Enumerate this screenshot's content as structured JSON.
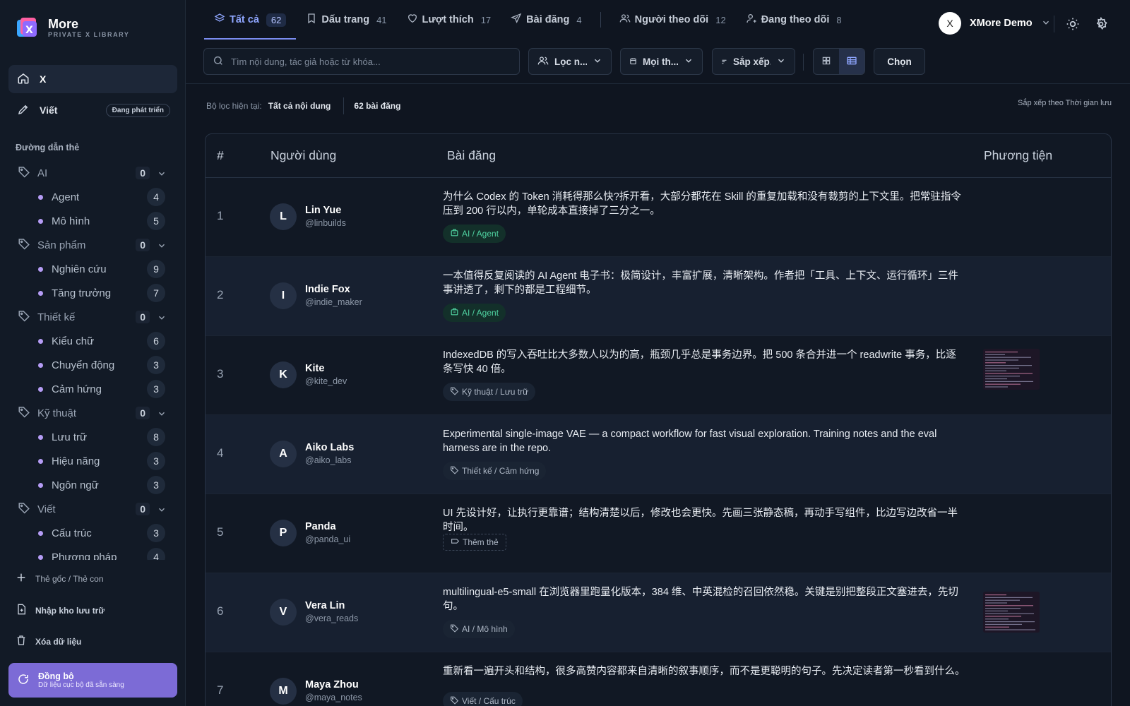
{
  "brand": {
    "title": "More",
    "subtitle": "PRIVATE X LIBRARY"
  },
  "sidebar": {
    "nav": [
      {
        "label": "X"
      },
      {
        "label": "Viết",
        "badge": "Đang phát triển"
      }
    ],
    "section_title": "Đường dẫn thẻ",
    "tree": [
      {
        "type": "parent",
        "label": "AI",
        "count": "0"
      },
      {
        "type": "child",
        "label": "Agent",
        "count": "4"
      },
      {
        "type": "child",
        "label": "Mô hình",
        "count": "5"
      },
      {
        "type": "parent",
        "label": "Sản phẩm",
        "count": "0"
      },
      {
        "type": "child",
        "label": "Nghiên cứu",
        "count": "9"
      },
      {
        "type": "child",
        "label": "Tăng trưởng",
        "count": "7"
      },
      {
        "type": "parent",
        "label": "Thiết kế",
        "count": "0"
      },
      {
        "type": "child",
        "label": "Kiểu chữ",
        "count": "6"
      },
      {
        "type": "child",
        "label": "Chuyển động",
        "count": "3"
      },
      {
        "type": "child",
        "label": "Cảm hứng",
        "count": "3"
      },
      {
        "type": "parent",
        "label": "Kỹ thuật",
        "count": "0"
      },
      {
        "type": "child",
        "label": "Lưu trữ",
        "count": "8"
      },
      {
        "type": "child",
        "label": "Hiệu năng",
        "count": "3"
      },
      {
        "type": "child",
        "label": "Ngôn ngữ",
        "count": "3"
      },
      {
        "type": "parent",
        "label": "Viết",
        "count": "0"
      },
      {
        "type": "child",
        "label": "Cấu trúc",
        "count": "3"
      },
      {
        "type": "child",
        "label": "Phương pháp",
        "count": "4"
      }
    ],
    "add_tag": "Thẻ gốc / Thẻ con",
    "import": "Nhập kho lưu trữ",
    "delete": "Xóa dữ liệu",
    "sync": {
      "title": "Đồng bộ",
      "subtitle": "Dữ liệu cục bộ đã sẵn sàng"
    }
  },
  "tabs": [
    {
      "label": "Tất cả",
      "count": "62",
      "icon": "layers-icon",
      "active": true
    },
    {
      "label": "Dấu trang",
      "count": "41",
      "icon": "bookmark-icon"
    },
    {
      "label": "Lượt thích",
      "count": "17",
      "icon": "heart-icon"
    },
    {
      "label": "Bài đăng",
      "count": "4",
      "icon": "send-icon"
    },
    {
      "label": "Người theo dõi",
      "count": "12",
      "icon": "users-icon"
    },
    {
      "label": "Đang theo dõi",
      "count": "8",
      "icon": "user-follow-icon"
    }
  ],
  "user": {
    "initial": "X",
    "name": "XMore Demo"
  },
  "toolbar": {
    "search_placeholder": "Tìm nội dung, tác giả hoặc từ khóa...",
    "filter_people": "Lọc n...",
    "filter_type": "Mọi th...",
    "sort": "Sắp xếp...",
    "choose": "Chọn"
  },
  "filter_info": {
    "label": "Bộ lọc hiện tại:",
    "value": "Tất cả nội dung",
    "count": "62 bài đăng",
    "sort": "Sắp xếp theo Thời gian lưu"
  },
  "table": {
    "headers": [
      "#",
      "Người dùng",
      "Bài đăng",
      "Phương tiện"
    ],
    "rows": [
      {
        "num": "1",
        "initial": "L",
        "name": "Lin Yue",
        "handle": "@linbuilds",
        "text": "为什么 Codex 的 Token 消耗得那么快?拆开看，大部分都花在 Skill 的重复加载和没有裁剪的上下文里。把常驻指令压到 200 行以内，单轮成本直接掉了三分之一。",
        "tag": "AI / Agent",
        "tag_style": "green",
        "media": false
      },
      {
        "num": "2",
        "initial": "I",
        "name": "Indie Fox",
        "handle": "@indie_maker",
        "text": "一本值得反复阅读的 AI Agent 电子书：极简设计，丰富扩展，清晰架构。作者把「工具、上下文、运行循环」三件事讲透了，剩下的都是工程细节。",
        "tag": "AI / Agent",
        "tag_style": "green",
        "media": false
      },
      {
        "num": "3",
        "initial": "K",
        "name": "Kite",
        "handle": "@kite_dev",
        "text": "IndexedDB 的写入吞吐比大多数人以为的高，瓶颈几乎总是事务边界。把 500 条合并进一个 readwrite 事务，比逐条写快 40 倍。",
        "tag": "Kỹ thuật / Lưu trữ",
        "tag_style": "gray",
        "media": true
      },
      {
        "num": "4",
        "initial": "A",
        "name": "Aiko Labs",
        "handle": "@aiko_labs",
        "text": "Experimental single-image VAE — a compact workflow for fast visual exploration. Training notes and the eval harness are in the repo.",
        "tag": "Thiết kế / Cảm hứng",
        "tag_style": "gray",
        "media": false
      },
      {
        "num": "5",
        "initial": "P",
        "name": "Panda",
        "handle": "@panda_ui",
        "text": "UI 先设计好，让执行更靠谱；结构清楚以后，修改也会更快。先画三张静态稿，再动手写组件，比边写边改省一半时间。",
        "tag": "Thêm thẻ",
        "tag_style": "dashed",
        "media": false
      },
      {
        "num": "6",
        "initial": "V",
        "name": "Vera Lin",
        "handle": "@vera_reads",
        "text": "multilingual-e5-small 在浏览器里跑量化版本，384 维、中英混检的召回依然稳。关键是别把整段正文塞进去，先切句。",
        "tag": "AI / Mô hình",
        "tag_style": "gray",
        "media": true
      },
      {
        "num": "7",
        "initial": "M",
        "name": "Maya Zhou",
        "handle": "@maya_notes",
        "text": "重新看一遍开头和结构，很多高赞内容都来自清晰的叙事顺序，而不是更聪明的句子。先决定读者第一秒看到什么。",
        "tag": "Viết / Cấu trúc",
        "tag_style": "gray",
        "media": false
      }
    ]
  },
  "colors": {
    "accent": "#8fa6ff",
    "sync": "#7c6bd6",
    "tag_green": "#4fd1a0",
    "tree_dot": "#b59cf5"
  }
}
